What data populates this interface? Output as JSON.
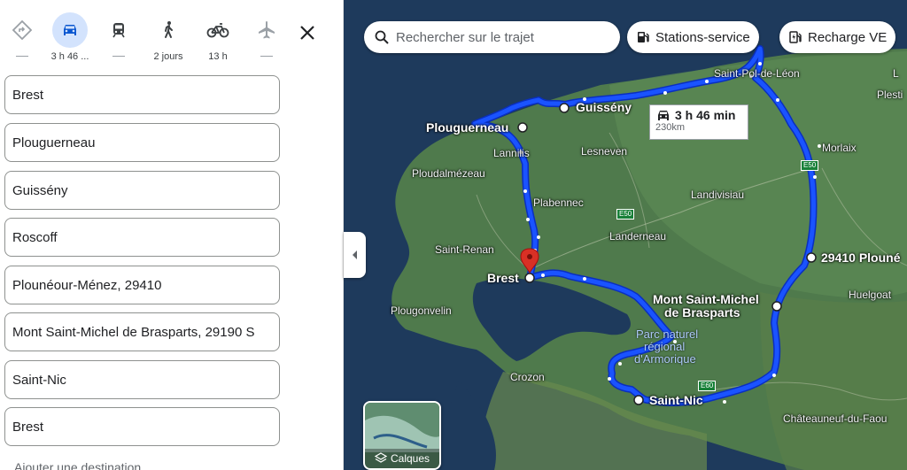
{
  "travel_modes": [
    {
      "name": "best",
      "label": ""
    },
    {
      "name": "driving",
      "label": "3 h 46 ..."
    },
    {
      "name": "transit",
      "label": ""
    },
    {
      "name": "walking",
      "label": "2 jours"
    },
    {
      "name": "cycling",
      "label": "13 h"
    },
    {
      "name": "flight",
      "label": ""
    }
  ],
  "stops": [
    "Brest",
    "Plouguerneau",
    "Guissény",
    "Roscoff",
    "Plounéour-Ménez, 29410",
    "Mont Saint-Michel de Brasparts, 29190 S",
    "Saint-Nic",
    "Brest"
  ],
  "more_text": "Ajouter une destination",
  "map": {
    "search_placeholder": "Rechercher sur le trajet",
    "chip_gas": "Stations-service",
    "chip_ev": "Recharge VE",
    "route_time": "3 h 46 min",
    "route_distance": "230km",
    "layers_label": "Calques",
    "route_color": "#1a53ff",
    "stop_labels": {
      "guisseny": "Guissény",
      "plouguerneau": "Plouguerneau",
      "brest": "Brest",
      "plouneour": "29410 Plouné",
      "mont_1": "Mont Saint-Michel",
      "mont_2": "de Brasparts",
      "saint_nic": "Saint-Nic"
    },
    "towns": {
      "saint_pol": "Saint-Pol-de-Léon",
      "morlaix": "Morlaix",
      "lannilis": "Lannilis",
      "lesneven": "Lesneven",
      "ploudalmezeau": "Ploudalmézeau",
      "plabennec": "Plabennec",
      "landivisiau": "Landivisiau",
      "landerneau": "Landerneau",
      "saint_renan": "Saint-Renan",
      "plougonvelin": "Plougonvelin",
      "huelgoat": "Huelgoat",
      "crozon": "Crozon",
      "chateauneuf": "Châteauneuf-du-Faou",
      "plestin": "Plesti",
      "l_edge": "L"
    },
    "park_1": "Parc naturel",
    "park_2": "régional",
    "park_3": "d'Armorique",
    "roads": {
      "e50_a": "E50",
      "e50_b": "E50",
      "e60": "E60"
    }
  }
}
